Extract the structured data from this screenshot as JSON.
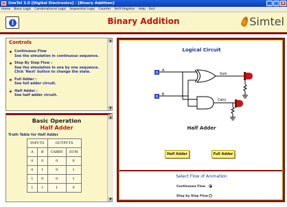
{
  "window": {
    "title": "SimTel 3.0 [Digital Electronics] - [Binary Addition]",
    "controls": [
      "_",
      "□",
      "x"
    ]
  },
  "menu": [
    "Home",
    "Basic Logic",
    "Combinational Logic",
    "Sequential Logic",
    "Counter",
    "Shift Register",
    "Help",
    "Exit"
  ],
  "header": {
    "info_icon": "i",
    "title": "Binary Addition",
    "logo_text": "Simtel"
  },
  "controls": {
    "title": "Controls",
    "items": [
      {
        "label": "Continuous Flow",
        "desc": "See the simulation in continuous sequence."
      },
      {
        "label": "Step By Step Flow :",
        "desc": "See the simulation in one by one sequence. Click 'Next' button to change the state."
      },
      {
        "label": "Full Adder :",
        "desc": "See full adder circuit."
      },
      {
        "label": "Half Adder :",
        "desc": "See half adder circuit."
      }
    ]
  },
  "basic": {
    "title": "Basic Operation",
    "subtitle": "Half Adder",
    "truth_caption": "Truth Table for Half Adder",
    "group_headers": [
      "INPUTS",
      "OUTPUTS"
    ],
    "columns": [
      "A",
      "B",
      "CARRY",
      "SUM"
    ],
    "rows": [
      [
        "0",
        "0",
        "0",
        "0"
      ],
      [
        "0",
        "1",
        "0",
        "1"
      ],
      [
        "1",
        "0",
        "0",
        "1"
      ],
      [
        "1",
        "1",
        "1",
        "0"
      ]
    ]
  },
  "circuit": {
    "title": "Logical Circuit",
    "input_a_label": "A",
    "input_b_label": "B",
    "input_a_value": "0",
    "input_b_value": "0",
    "sum_label": "Sum",
    "carry_label": "Carry",
    "caption": "Half Adder"
  },
  "buttons": {
    "half_adder": "Half Adder",
    "full_adder": "Full Adder"
  },
  "flow": {
    "title": "Select Flow of Animation",
    "continuous_label": "Continuous Flow",
    "step_label": "Step by Step Flow",
    "selected": "continuous"
  }
}
